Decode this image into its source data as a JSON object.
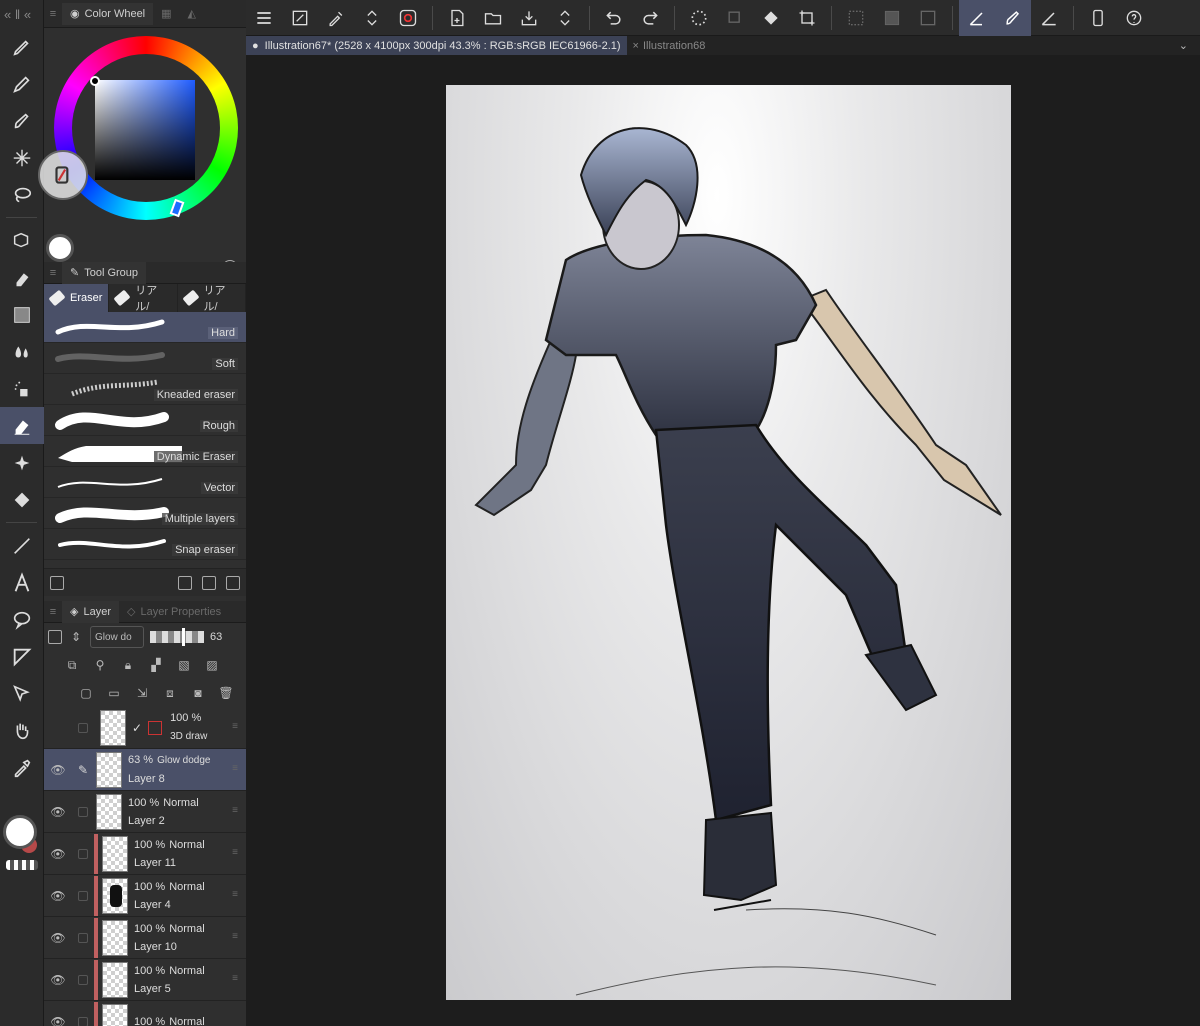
{
  "color_wheel": {
    "tab_label": "Color Wheel",
    "r": "255",
    "g": "255",
    "b": "255"
  },
  "tool_group": {
    "tab_label": "Tool Group",
    "subtabs": [
      "Eraser",
      "リアル/",
      "リアル/"
    ],
    "brushes": [
      "Hard",
      "Soft",
      "Kneaded eraser",
      "Rough",
      "Dynamic Eraser",
      "Vector",
      "Multiple layers",
      "Snap eraser"
    ]
  },
  "layer_panel": {
    "tab_label": "Layer",
    "tab2_label": "Layer Properties",
    "blend_mode": "Glow do",
    "opacity": "63",
    "layers": [
      {
        "pct": "100 %",
        "mode": "",
        "name": "3D draw"
      },
      {
        "pct": "63 %",
        "mode": "Glow dodge",
        "name": "Layer 8"
      },
      {
        "pct": "100 %",
        "mode": "Normal",
        "name": "Layer 2"
      },
      {
        "pct": "100 %",
        "mode": "Normal",
        "name": "Layer 11"
      },
      {
        "pct": "100 %",
        "mode": "Normal",
        "name": "Layer 4"
      },
      {
        "pct": "100 %",
        "mode": "Normal",
        "name": "Layer 10"
      },
      {
        "pct": "100 %",
        "mode": "Normal",
        "name": "Layer 5"
      },
      {
        "pct": "100 %",
        "mode": "Normal",
        "name": ""
      }
    ]
  },
  "doc_tabs": {
    "active": "Illustration67* (2528 x 4100px 300dpi 43.3% : RGB:sRGB IEC61966-2.1)",
    "other": "Illustration68"
  },
  "colors": {
    "panel_bg": "#2f2f2f",
    "selection": "#4a5068",
    "canvas_bg": "#1d1d1d"
  }
}
